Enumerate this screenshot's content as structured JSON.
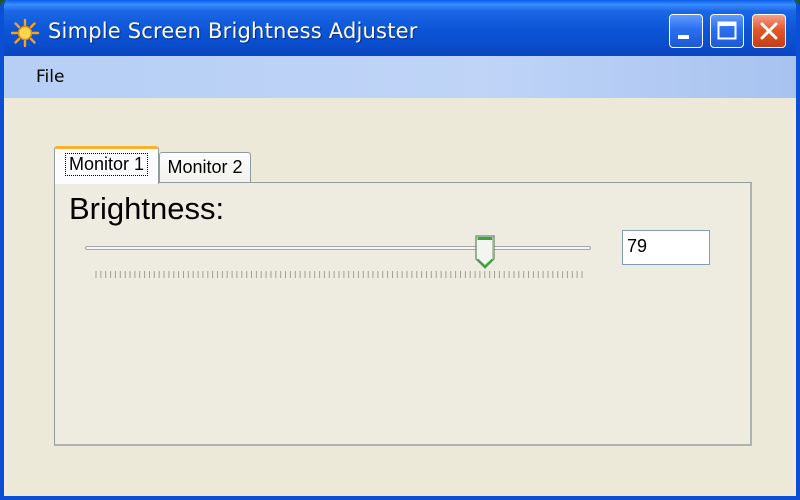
{
  "window": {
    "title": "Simple Screen Brightness Adjuster",
    "app_icon": "sun-icon",
    "controls": [
      "minimize-icon",
      "maximize-icon",
      "close-icon"
    ]
  },
  "menu": {
    "file": "File"
  },
  "tabs": [
    {
      "label": "Monitor 1",
      "selected": true
    },
    {
      "label": "Monitor 2",
      "selected": false
    }
  ],
  "panel": {
    "heading": "Brightness:",
    "slider": {
      "min": 0,
      "max": 100,
      "value": 79
    },
    "value_text": "79"
  },
  "colors": {
    "titlebar": "#0a4fd6",
    "window_face": "#ece9d8",
    "menubar": "#b7cff5",
    "tab_accent": "#f8b230",
    "close_button": "#e2582e",
    "thumb_accent": "#3aa53a"
  }
}
